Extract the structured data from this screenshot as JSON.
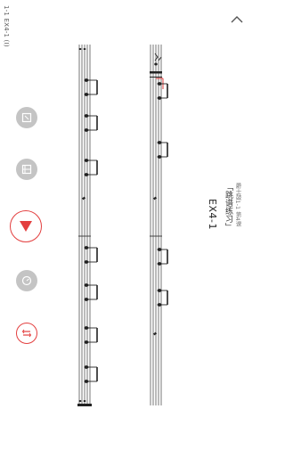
{
  "status": {
    "text": "1-1 EX4-1 (I)"
  },
  "toolbar": {
    "tools": [
      {
        "name": "score-view-icon"
      },
      {
        "name": "layout-icon"
      },
      {
        "name": "play-icon"
      },
      {
        "name": "timer-icon"
      },
      {
        "name": "tempo-adjust-icon"
      }
    ],
    "accent_color": "#e33f3f",
    "grey_color": "#c4c4c4"
  },
  "title": {
    "subtitle": "爵士鼓1-1 第4课",
    "heading": "「跳谱练习」",
    "code": "EX4-1"
  }
}
